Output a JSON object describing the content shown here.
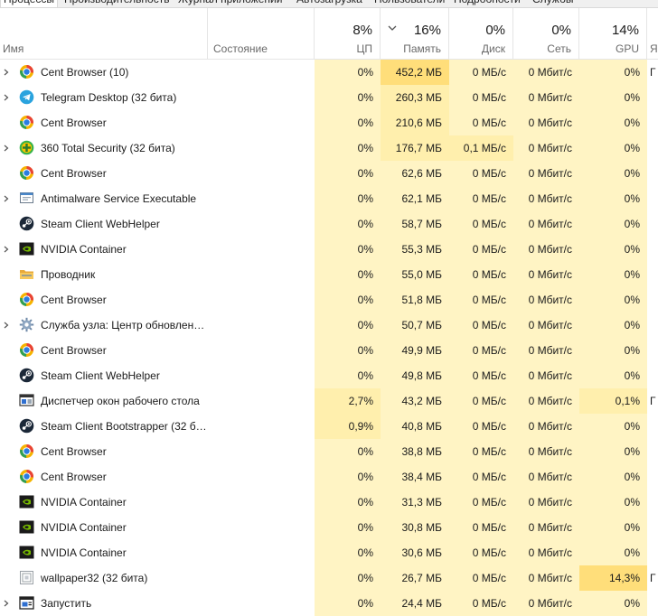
{
  "tabs": [
    {
      "label": "Процессы",
      "active": true
    },
    {
      "label": "Производительность"
    },
    {
      "label": "Журнал приложений"
    },
    {
      "label": "Автозагрузка"
    },
    {
      "label": "Пользователи"
    },
    {
      "label": "Подробности"
    },
    {
      "label": "Службы"
    }
  ],
  "columns": {
    "name": {
      "label": "Имя"
    },
    "status": {
      "label": "Состояние"
    },
    "cpu": {
      "label": "ЦП",
      "total": "8%"
    },
    "memory": {
      "label": "Память",
      "total": "16%"
    },
    "disk": {
      "label": "Диск",
      "total": "0%"
    },
    "network": {
      "label": "Сеть",
      "total": "0%"
    },
    "gpu": {
      "label": "GPU",
      "total": "14%"
    },
    "gpu_engine": {
      "label": "Я"
    }
  },
  "rows": [
    {
      "name": "Cent Browser (10)",
      "icon": "cent-browser-icon",
      "expand": true,
      "cpu": "0%",
      "mem": "452,2 МБ",
      "disk": "0 МБ/с",
      "net": "0 Мбит/с",
      "gpu": "0%",
      "eng": "Г"
    },
    {
      "name": "Telegram Desktop (32 бита)",
      "icon": "telegram-icon",
      "expand": true,
      "cpu": "0%",
      "mem": "260,3 МБ",
      "disk": "0 МБ/с",
      "net": "0 Мбит/с",
      "gpu": "0%",
      "eng": ""
    },
    {
      "name": "Cent Browser",
      "icon": "cent-browser-icon",
      "expand": false,
      "cpu": "0%",
      "mem": "210,6 МБ",
      "disk": "0 МБ/с",
      "net": "0 Мбит/с",
      "gpu": "0%",
      "eng": ""
    },
    {
      "name": "360 Total Security (32 бита)",
      "icon": "total-security-icon",
      "expand": true,
      "cpu": "0%",
      "mem": "176,7 МБ",
      "disk": "0,1 МБ/с",
      "net": "0 Мбит/с",
      "gpu": "0%",
      "eng": ""
    },
    {
      "name": "Cent Browser",
      "icon": "cent-browser-icon",
      "expand": false,
      "cpu": "0%",
      "mem": "62,6 МБ",
      "disk": "0 МБ/с",
      "net": "0 Мбит/с",
      "gpu": "0%",
      "eng": ""
    },
    {
      "name": "Antimalware Service Executable",
      "icon": "service-icon",
      "expand": true,
      "cpu": "0%",
      "mem": "62,1 МБ",
      "disk": "0 МБ/с",
      "net": "0 Мбит/с",
      "gpu": "0%",
      "eng": ""
    },
    {
      "name": "Steam Client WebHelper",
      "icon": "steam-icon",
      "expand": false,
      "cpu": "0%",
      "mem": "58,7 МБ",
      "disk": "0 МБ/с",
      "net": "0 Мбит/с",
      "gpu": "0%",
      "eng": ""
    },
    {
      "name": "NVIDIA Container",
      "icon": "nvidia-icon",
      "expand": true,
      "cpu": "0%",
      "mem": "55,3 МБ",
      "disk": "0 МБ/с",
      "net": "0 Мбит/с",
      "gpu": "0%",
      "eng": ""
    },
    {
      "name": "Проводник",
      "icon": "folder-icon",
      "expand": false,
      "cpu": "0%",
      "mem": "55,0 МБ",
      "disk": "0 МБ/с",
      "net": "0 Мбит/с",
      "gpu": "0%",
      "eng": ""
    },
    {
      "name": "Cent Browser",
      "icon": "cent-browser-icon",
      "expand": false,
      "cpu": "0%",
      "mem": "51,8 МБ",
      "disk": "0 МБ/с",
      "net": "0 Мбит/с",
      "gpu": "0%",
      "eng": ""
    },
    {
      "name": "Служба узла: Центр обновлен…",
      "icon": "gear-icon",
      "expand": true,
      "cpu": "0%",
      "mem": "50,7 МБ",
      "disk": "0 МБ/с",
      "net": "0 Мбит/с",
      "gpu": "0%",
      "eng": ""
    },
    {
      "name": "Cent Browser",
      "icon": "cent-browser-icon",
      "expand": false,
      "cpu": "0%",
      "mem": "49,9 МБ",
      "disk": "0 МБ/с",
      "net": "0 Мбит/с",
      "gpu": "0%",
      "eng": ""
    },
    {
      "name": "Steam Client WebHelper",
      "icon": "steam-icon",
      "expand": false,
      "cpu": "0%",
      "mem": "49,8 МБ",
      "disk": "0 МБ/с",
      "net": "0 Мбит/с",
      "gpu": "0%",
      "eng": ""
    },
    {
      "name": "Диспетчер окон рабочего стола",
      "icon": "dwm-window-icon",
      "expand": false,
      "cpu": "2,7%",
      "mem": "43,2 МБ",
      "disk": "0 МБ/с",
      "net": "0 Мбит/с",
      "gpu": "0,1%",
      "eng": "Г"
    },
    {
      "name": "Steam Client Bootstrapper (32 б…",
      "icon": "steam-icon",
      "expand": false,
      "cpu": "0,9%",
      "mem": "40,8 МБ",
      "disk": "0 МБ/с",
      "net": "0 Мбит/с",
      "gpu": "0%",
      "eng": ""
    },
    {
      "name": "Cent Browser",
      "icon": "cent-browser-icon",
      "expand": false,
      "cpu": "0%",
      "mem": "38,8 МБ",
      "disk": "0 МБ/с",
      "net": "0 Мбит/с",
      "gpu": "0%",
      "eng": ""
    },
    {
      "name": "Cent Browser",
      "icon": "cent-browser-icon",
      "expand": false,
      "cpu": "0%",
      "mem": "38,4 МБ",
      "disk": "0 МБ/с",
      "net": "0 Мбит/с",
      "gpu": "0%",
      "eng": ""
    },
    {
      "name": "NVIDIA Container",
      "icon": "nvidia-icon",
      "expand": false,
      "cpu": "0%",
      "mem": "31,3 МБ",
      "disk": "0 МБ/с",
      "net": "0 Мбит/с",
      "gpu": "0%",
      "eng": ""
    },
    {
      "name": "NVIDIA Container",
      "icon": "nvidia-icon",
      "expand": false,
      "cpu": "0%",
      "mem": "30,8 МБ",
      "disk": "0 МБ/с",
      "net": "0 Мбит/с",
      "gpu": "0%",
      "eng": ""
    },
    {
      "name": "NVIDIA Container",
      "icon": "nvidia-icon",
      "expand": false,
      "cpu": "0%",
      "mem": "30,6 МБ",
      "disk": "0 МБ/с",
      "net": "0 Мбит/с",
      "gpu": "0%",
      "eng": ""
    },
    {
      "name": "wallpaper32 (32 бита)",
      "icon": "wallpaper-app-icon",
      "expand": false,
      "cpu": "0%",
      "mem": "26,7 МБ",
      "disk": "0 МБ/с",
      "net": "0 Мбит/с",
      "gpu": "14,3%",
      "eng": "Г"
    },
    {
      "name": "Запустить",
      "icon": "run-dialog-icon",
      "expand": true,
      "cpu": "0%",
      "mem": "24,4 МБ",
      "disk": "0 МБ/с",
      "net": "0 Мбит/с",
      "gpu": "0%",
      "eng": ""
    }
  ],
  "heat_colors": {
    "low": "#fff4c4",
    "mid": "#ffefad",
    "high": "#ffe799",
    "strong": "#ffde7a"
  }
}
